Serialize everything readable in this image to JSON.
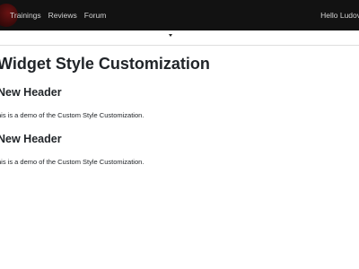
{
  "navbar": {
    "links": [
      "Trainings",
      "Reviews",
      "Forum"
    ],
    "user_greeting": "Hello Ludov"
  },
  "page": {
    "title": "Widget Style Customization",
    "sections": [
      {
        "header": "New Header",
        "text": "his is a demo of the Custom Style Customization."
      },
      {
        "header": "New Header",
        "text": "his is a demo of the Custom Style Customization."
      }
    ]
  }
}
